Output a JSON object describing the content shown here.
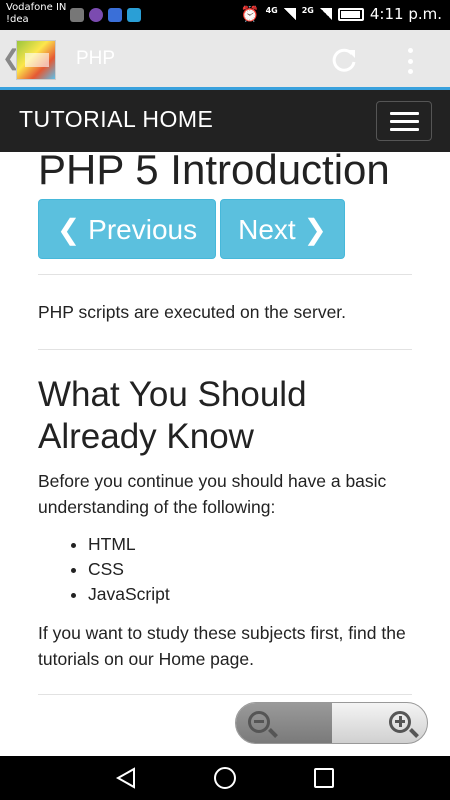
{
  "status_bar": {
    "carrier_line1": "Vodafone IN",
    "carrier_line2": "!dea",
    "net1": "4G",
    "net2": "2G",
    "time": "4:11 p.m.",
    "notification_colors": [
      "#777777",
      "#7b4bb0",
      "#3a6fd8",
      "#2a9fd6"
    ]
  },
  "app_bar": {
    "title": "PHP",
    "accent_color": "#39a1dd"
  },
  "site_nav": {
    "title": "TUTORIAL HOME"
  },
  "content": {
    "heading": "PHP 5 Introduction",
    "prev_button": "❮ Previous",
    "next_button": "Next ❯",
    "intro_text": "PHP scripts are executed on the server.",
    "section_heading": "What You Should Already Know",
    "section_text": "Before you continue you should have a basic understanding of the following:",
    "list_items": [
      "HTML",
      "CSS",
      "JavaScript"
    ],
    "footer_text": "If you want to study these subjects first, find the tutorials on our Home page."
  },
  "colors": {
    "button_bg": "#5bc0de",
    "nav_bg": "#222222"
  }
}
